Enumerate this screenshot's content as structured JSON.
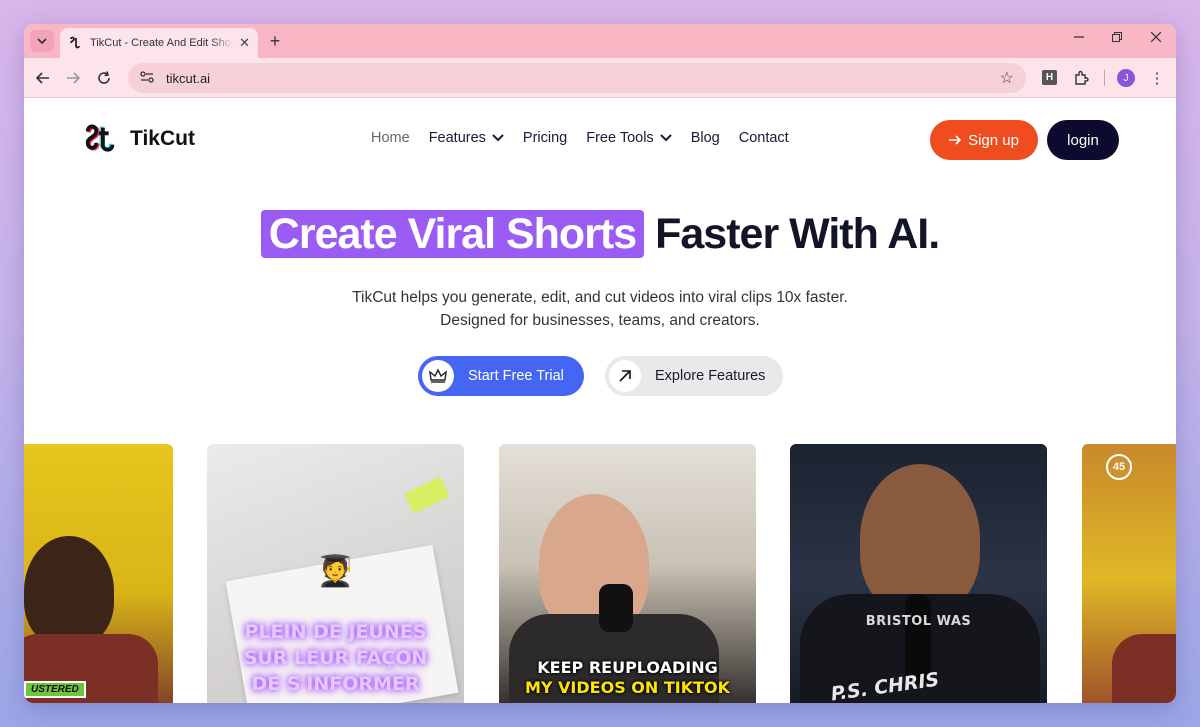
{
  "browser": {
    "tab_title": "TikCut - Create And Edit Short Videos",
    "tab_close": "✕",
    "new_tab": "+",
    "url": "tikcut.ai",
    "ext_h": "H",
    "profile_initial": "J",
    "menu_dots": "⋮"
  },
  "nav": {
    "brand": "TikCut",
    "links": [
      {
        "label": "Home"
      },
      {
        "label": "Features"
      },
      {
        "label": "Pricing"
      },
      {
        "label": "Free Tools"
      },
      {
        "label": "Blog"
      },
      {
        "label": "Contact"
      }
    ],
    "signup": "Sign up",
    "login": "login"
  },
  "hero": {
    "title_highlight": "Create Viral Shorts",
    "title_rest": "Faster With AI.",
    "subtitle_line1": "TikCut helps you generate, edit, and cut videos into viral clips 10x faster.",
    "subtitle_line2": "Designed for businesses, teams, and creators.",
    "cta_trial": "Start Free Trial",
    "cta_explore": "Explore Features"
  },
  "cards": [
    {
      "caption": "USTERED"
    },
    {
      "caption_lines": [
        "PLEIN DE JEUNES",
        "SUR LEUR FAÇON",
        "DE S'INFORMER"
      ],
      "emoji": "🧑‍🎓"
    },
    {
      "caption_line1": "KEEP REUPLOADING",
      "caption_line2": "MY VIDEOS ON TIKTOK"
    },
    {
      "caption": "BRISTOL WAS",
      "shirt_text": "P.S. CHRIS"
    },
    {
      "badge": "45"
    }
  ],
  "colors": {
    "accent_purple": "#9b5cf6",
    "signup_orange": "#ef4d1f",
    "login_navy": "#0c0a2e",
    "trial_blue": "#4466f2"
  }
}
